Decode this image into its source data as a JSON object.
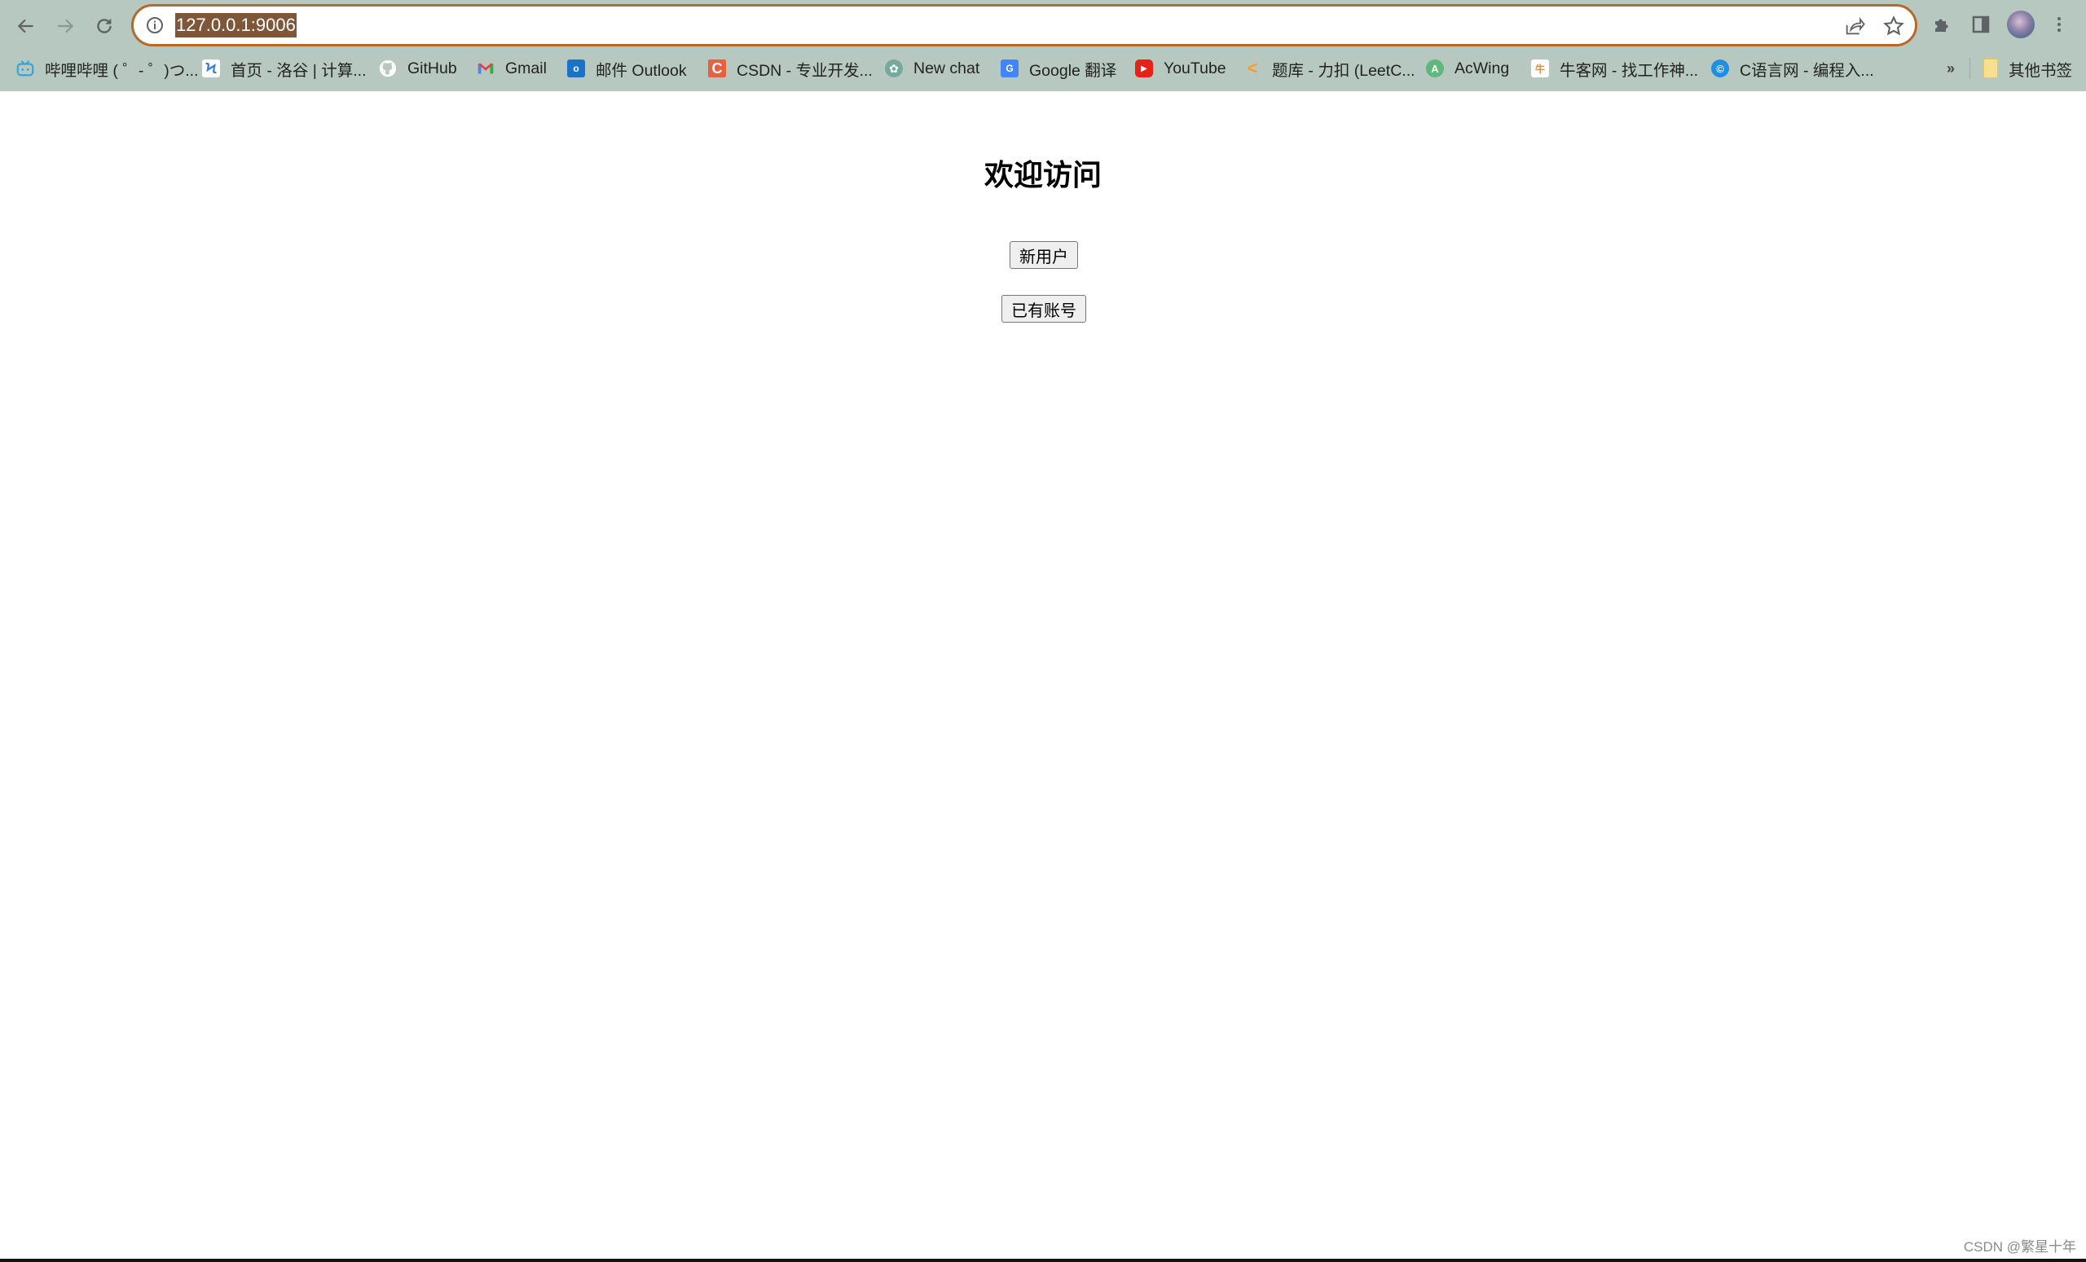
{
  "browser": {
    "url": "127.0.0.1:9006",
    "icons": {
      "back": "arrow-left",
      "forward": "arrow-right",
      "reload": "reload",
      "site_info": "info-circle",
      "share": "share",
      "bookmark_star": "star",
      "extensions": "puzzle",
      "side_panel": "side-panel",
      "profile": "avatar",
      "menu": "kebab-menu"
    },
    "bookmarks": [
      {
        "label": "哔哩哔哩 ( ゜- ゜)つ...",
        "icon": "bilibili"
      },
      {
        "label": "首页 - 洛谷 | 计算...",
        "icon": "luogu"
      },
      {
        "label": "GitHub",
        "icon": "github"
      },
      {
        "label": "Gmail",
        "icon": "gmail"
      },
      {
        "label": "邮件 Outlook",
        "icon": "outlook"
      },
      {
        "label": "CSDN - 专业开发...",
        "icon": "csdn"
      },
      {
        "label": "New chat",
        "icon": "chatgpt"
      },
      {
        "label": "Google 翻译",
        "icon": "google-translate"
      },
      {
        "label": "YouTube",
        "icon": "youtube"
      },
      {
        "label": "题库 - 力扣 (LeetC...",
        "icon": "leetcode"
      },
      {
        "label": "AcWing",
        "icon": "acwing"
      },
      {
        "label": "牛客网 - 找工作神...",
        "icon": "nowcoder"
      },
      {
        "label": "C语言网 - 编程入...",
        "icon": "dotcpp"
      }
    ],
    "overflow_label": "»",
    "other_bookmarks": "其他书签"
  },
  "page": {
    "heading": "欢迎访问",
    "new_user_button": "新用户",
    "existing_account_button": "已有账号"
  },
  "watermark": "CSDN @繁星十年",
  "colors": {
    "toolbar_bg": "#b7c8c1",
    "omnibox_border": "#b5692a",
    "url_highlight": "#7f5638"
  }
}
